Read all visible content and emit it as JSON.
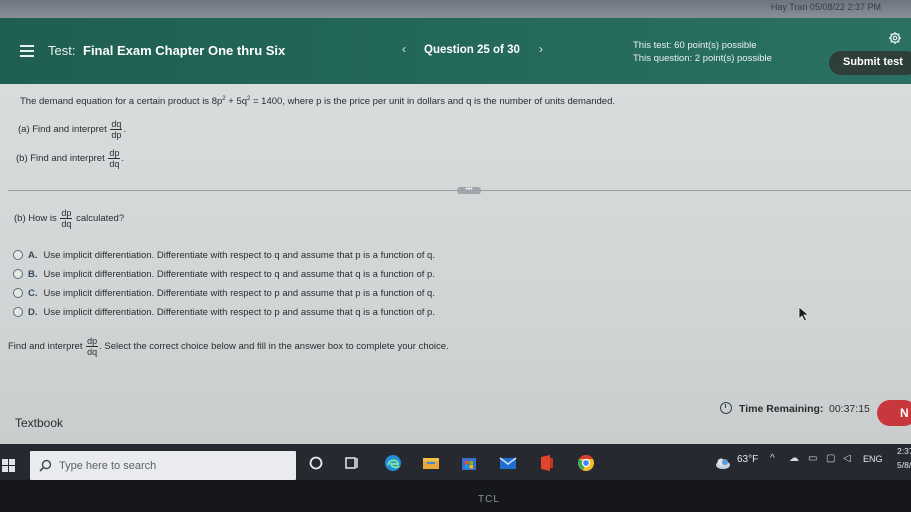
{
  "topstrip": {
    "text": "Hay Tran 05/08/22 2:37 PM"
  },
  "header": {
    "test_label": "Test:",
    "test_name": "Final Exam Chapter One thru Six",
    "prev": "‹",
    "question_label": "Question 25 of 30",
    "next": "›",
    "points_test": "This test: 60 point(s) possible",
    "points_question": "This question: 2 point(s) possible",
    "submit_label": "Submit test"
  },
  "problem": {
    "intro_pre": "The demand equation for a certain product is 8p",
    "intro_sup1": "2",
    "intro_mid": " + 5q",
    "intro_sup2": "2",
    "intro_post": " = 1400, where p is the price per unit in dollars and q is the number of units demanded.",
    "part_a_label": "(a) Find and interpret",
    "part_a_num": "dq",
    "part_a_den": "dp",
    "part_b_label": "(b) Find and interpret",
    "part_b_num": "dp",
    "part_b_den": "dq",
    "handle_text": "•••"
  },
  "question": {
    "prompt_pre": "(b) How is",
    "prompt_num": "dp",
    "prompt_den": "dq",
    "prompt_post": "calculated?",
    "options": [
      {
        "letter": "A.",
        "text": "Use implicit differentiation. Differentiate with respect to q and assume that p is a function of q."
      },
      {
        "letter": "B.",
        "text": "Use implicit differentiation. Differentiate with respect to q and assume that q is a function of p."
      },
      {
        "letter": "C.",
        "text": "Use implicit differentiation. Differentiate with respect to p and assume that p is a function of q."
      },
      {
        "letter": "D.",
        "text": "Use implicit differentiation. Differentiate with respect to p and assume that q is a function of p."
      }
    ],
    "followup_pre": "Find and interpret",
    "followup_num": "dp",
    "followup_den": "dq",
    "followup_post": "Select the correct choice below and fill in the answer box to complete your choice."
  },
  "footer": {
    "textbook": "Textbook",
    "time_label": "Time Remaining:",
    "time_value": "00:37:15",
    "next_label": "N"
  },
  "taskbar": {
    "search_placeholder": "Type here to search",
    "weather_temp": "63°F",
    "lang": "ENG",
    "time": "2:37",
    "date": "5/8/"
  },
  "bezel": {
    "brand": "TCL"
  },
  "colors": {
    "header": "#24695c",
    "submit": "#2e3e3a",
    "next": "#c7373b",
    "taskbar": "#262a30"
  }
}
